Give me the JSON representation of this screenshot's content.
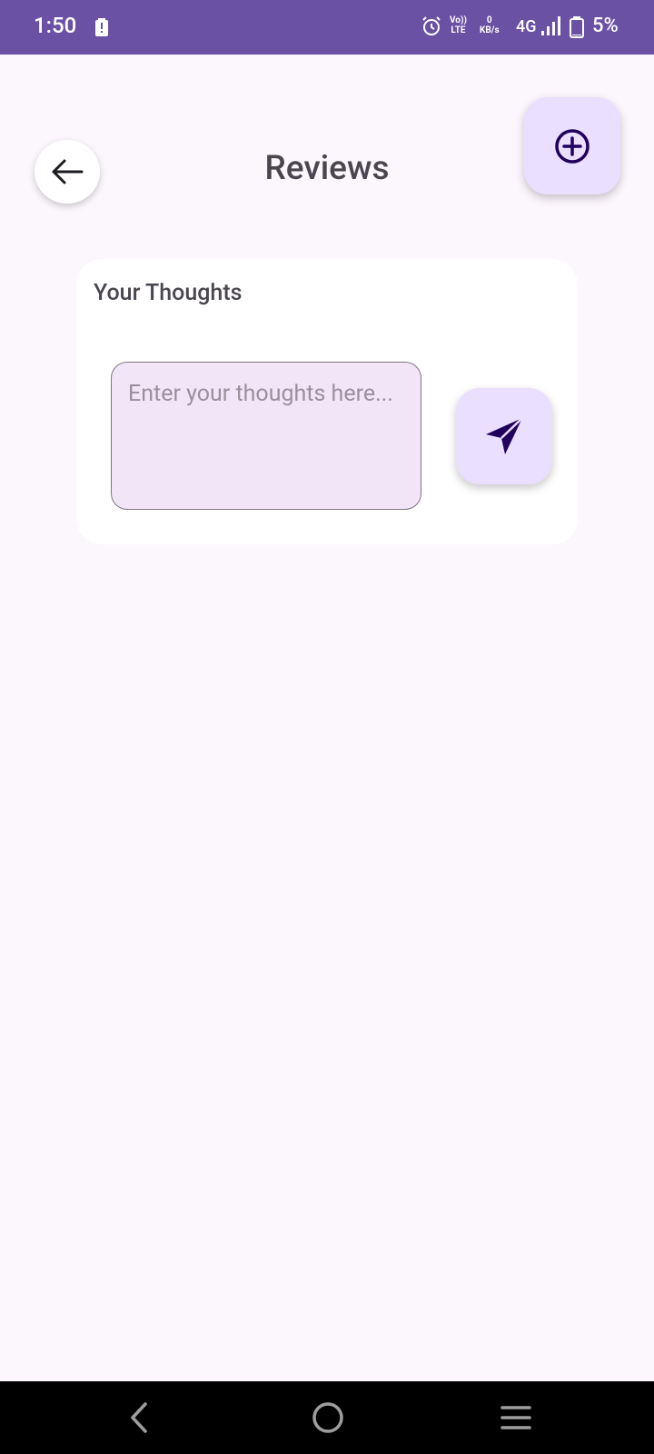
{
  "status_bar": {
    "time": "1:50",
    "volte_top": "Vo))",
    "volte_bottom": "LTE",
    "speed_value": "0",
    "speed_unit": "KB/s",
    "network": "4G",
    "battery_percent": "5%"
  },
  "header": {
    "title": "Reviews",
    "back_icon": "arrow-left-icon",
    "add_icon": "plus-circle-icon"
  },
  "review_card": {
    "title": "Your Thoughts",
    "input_placeholder": "Enter your thoughts here...",
    "input_value": "",
    "send_icon": "send-icon"
  },
  "colors": {
    "status_bar": "#6a51a4",
    "background": "#fcf6fd",
    "accent_container": "#eadfff",
    "accent_icon": "#21005d",
    "input_fill": "#f2e5f8"
  }
}
